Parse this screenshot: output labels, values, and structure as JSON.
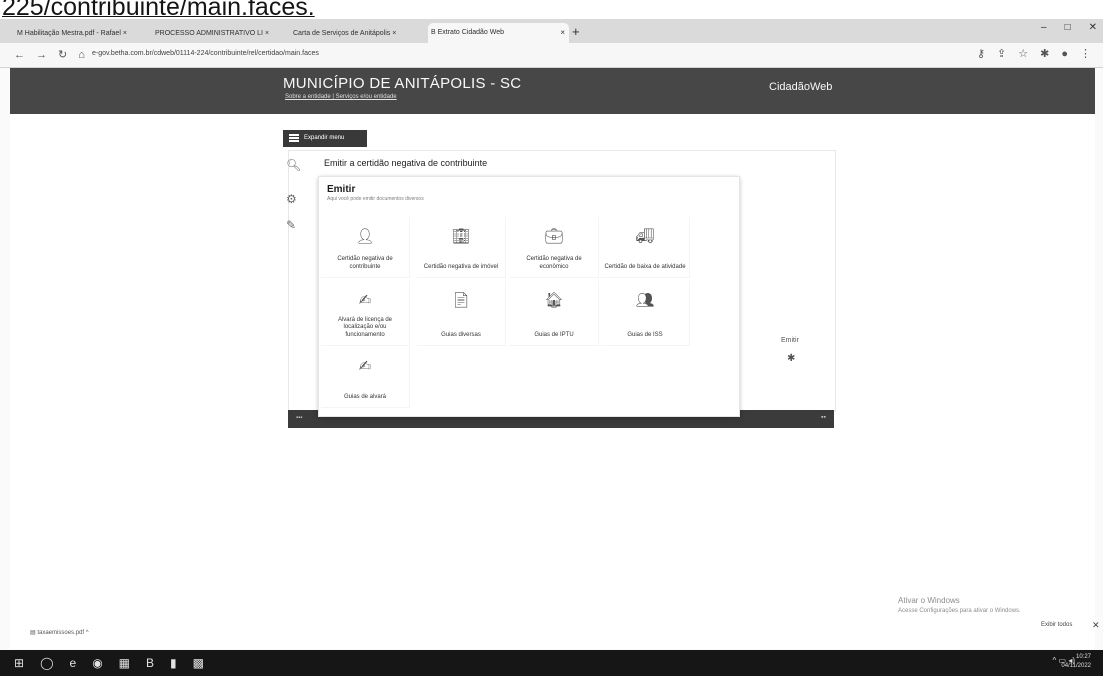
{
  "caption": "225/contribuinte/main.faces.",
  "browser": {
    "tabs": [
      {
        "label": "M  Habilitação Mestra.pdf - Rafael ×"
      },
      {
        "label": "PROCESSO ADMINISTRATIVO LI ×"
      },
      {
        "label": "Carta de Serviços de Anitápolis  ×"
      },
      {
        "label": "B  Extrato Cidadão Web"
      }
    ],
    "new_tab": "+",
    "url": "e-gov.betha.com.br/cdweb/01114-224/contribuinte/rel/certidao/main.faces"
  },
  "site": {
    "title": "MUNICÍPIO DE ANITÁPOLIS - SC",
    "subtitle": "Sobre a entidade | Serviços e/ou entidade",
    "brand": "CidadãoWeb"
  },
  "menu_button": "Expandir menu",
  "breadcrumb": "Emitir a certidão negativa de contribuinte",
  "side_emitir": "Emitir",
  "dropdown": {
    "title": "Emitir",
    "description": "Aqui você pode emitir documentos diversos",
    "items": [
      {
        "label": "Certidão negativa de contribuinte",
        "icon": "person-icon"
      },
      {
        "label": "Certidão negativa de imóvel",
        "icon": "building-icon"
      },
      {
        "label": "Certidão negativa de econômico",
        "icon": "briefcase-icon"
      },
      {
        "label": "Certidão de baixa de atividade",
        "icon": "truck-icon"
      },
      {
        "label": "Alvará de licença de localização e/ou funcionamento",
        "icon": "stamp-icon"
      },
      {
        "label": "Guias diversas",
        "icon": "document-icon"
      },
      {
        "label": "Guias de IPTU",
        "icon": "house-icon"
      },
      {
        "label": "Guias de ISS",
        "icon": "person-desk-icon"
      },
      {
        "label": "Guias de alvará",
        "icon": "stamp-icon"
      }
    ]
  },
  "download_item": "taxaemissoes.pdf",
  "windows": {
    "activate": "Ativar o Windows",
    "activate_hint": "Acesse Configurações para ativar o Windows.",
    "show_all": "Exibir todos",
    "clock_time": "10:27",
    "clock_date": "04/11/2022"
  }
}
